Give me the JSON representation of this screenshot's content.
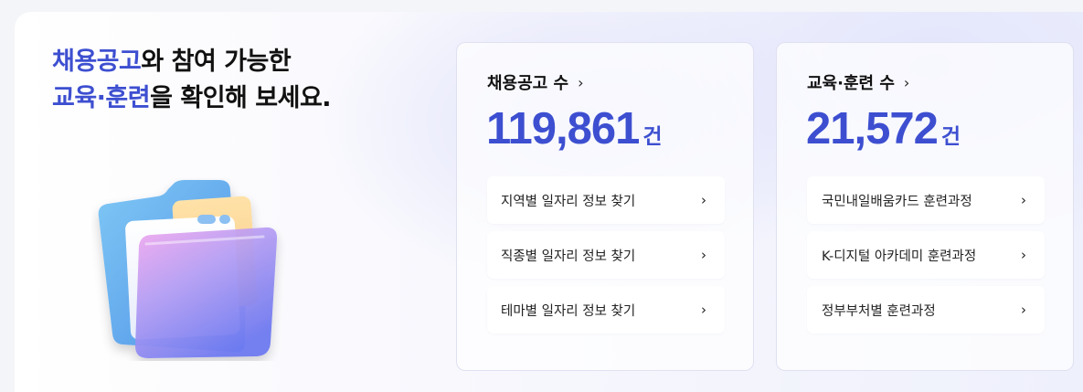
{
  "headline": {
    "line1_highlight": "채용공고",
    "line1_rest": "와 참여 가능한",
    "line2_highlight": "교육·훈련",
    "line2_rest": "을 확인해 보세요."
  },
  "jobs_card": {
    "title": "채용공고 수",
    "chevron": "›",
    "count": "119,861",
    "unit": "건",
    "links": [
      {
        "label": "지역별 일자리 정보 찾기",
        "icon": "chevron-right-icon"
      },
      {
        "label": "직종별 일자리 정보 찾기",
        "icon": "chevron-right-icon"
      },
      {
        "label": "테마별 일자리 정보 찾기",
        "icon": "chevron-right-icon"
      }
    ]
  },
  "edu_card": {
    "title": "교육·훈련 수",
    "chevron": "›",
    "count": "21,572",
    "unit": "건",
    "links": [
      {
        "label": "국민내일배움카드 훈련과정",
        "icon": "chevron-right-icon"
      },
      {
        "label": "K-디지털 아카데미 훈련과정",
        "icon": "chevron-right-icon"
      },
      {
        "label": "정부부처별 훈련과정",
        "icon": "chevron-right-icon"
      }
    ]
  },
  "colors": {
    "accent": "#3d4fd0",
    "text": "#111111"
  },
  "illustration": "folder-icon"
}
